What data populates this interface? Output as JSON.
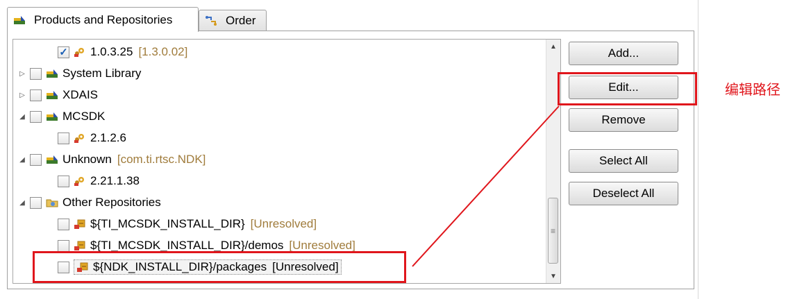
{
  "tabs": [
    {
      "label": "Products and Repositories",
      "icon": "products-icon"
    },
    {
      "label": "Order",
      "icon": "order-icon"
    }
  ],
  "tree": {
    "rows": [
      {
        "label": "1.0.3.25",
        "qualifier": "[1.3.0.02]",
        "checked": true,
        "icon": "version-icon",
        "level": 1
      },
      {
        "label": "System Library",
        "qualifier": "",
        "checked": false,
        "icon": "product-icon",
        "level": 0,
        "expander": "collapsed"
      },
      {
        "label": "XDAIS",
        "qualifier": "",
        "checked": false,
        "icon": "product-icon",
        "level": 0,
        "expander": "collapsed"
      },
      {
        "label": "MCSDK",
        "qualifier": "",
        "checked": false,
        "icon": "product-icon",
        "level": 0,
        "expander": "expanded"
      },
      {
        "label": "2.1.2.6",
        "qualifier": "",
        "checked": false,
        "icon": "version-icon",
        "level": 1
      },
      {
        "label": "Unknown",
        "qualifier": "[com.ti.rtsc.NDK]",
        "checked": false,
        "icon": "product-icon",
        "level": 0,
        "expander": "expanded"
      },
      {
        "label": "2.21.1.38",
        "qualifier": "",
        "checked": false,
        "icon": "version-icon",
        "level": 1
      },
      {
        "label": "Other Repositories",
        "qualifier": "",
        "checked": false,
        "icon": "repository-folder-icon",
        "level": 0,
        "expander": "expanded"
      },
      {
        "label": "${TI_MCSDK_INSTALL_DIR}",
        "qualifier": "[Unresolved]",
        "checked": false,
        "icon": "unresolved-repo-icon",
        "level": 1
      },
      {
        "label": "${TI_MCSDK_INSTALL_DIR}/demos",
        "qualifier": "[Unresolved]",
        "checked": false,
        "icon": "unresolved-repo-icon",
        "level": 1
      },
      {
        "label": "${NDK_INSTALL_DIR}/packages",
        "qualifier": "[Unresolved]",
        "checked": false,
        "icon": "unresolved-repo-icon",
        "level": 1,
        "selected": true
      }
    ]
  },
  "buttons": {
    "add": "Add...",
    "edit": "Edit...",
    "remove": "Remove",
    "select_all": "Select All",
    "deselect_all": "Deselect All"
  },
  "annotation": {
    "text": "编辑路径",
    "color": "#e0161c"
  },
  "colors": {
    "qualifier": "#a07c3c",
    "check": "#1a5fb4"
  }
}
